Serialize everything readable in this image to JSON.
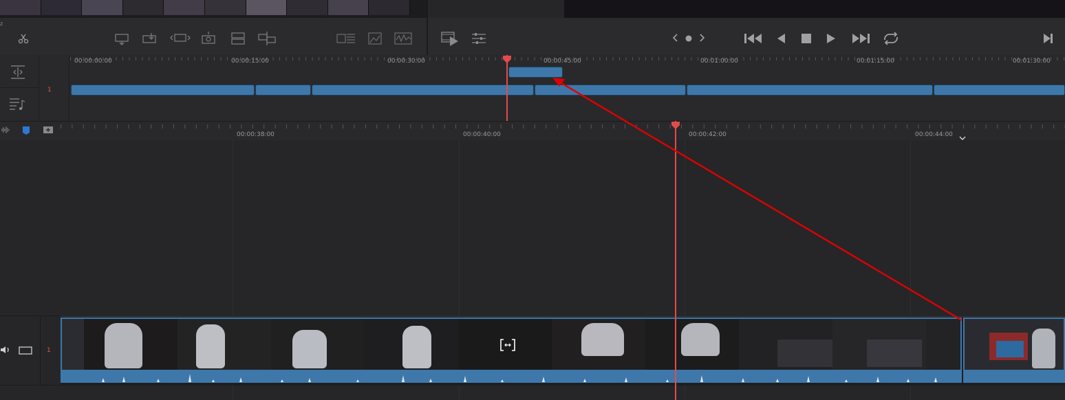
{
  "toolbar": {
    "left_icons": [
      "cut-icon",
      "insert-clip-icon",
      "overwrite-clip-icon",
      "replace-clip-icon",
      "place-on-top-icon",
      "append-icon",
      "ripple-overwrite-icon",
      "close-up-icon",
      "source-overwrite-icon",
      "audio-meter-icon"
    ],
    "right_icons": [
      "play-clip-icon",
      "settings-sliders-icon"
    ],
    "transport": [
      "prev-marker-icon",
      "marker-dot-icon",
      "next-marker-icon",
      "skip-start-icon",
      "play-reverse-icon",
      "stop-icon",
      "play-icon",
      "skip-end-icon",
      "loop-icon",
      "next-frame-icon"
    ]
  },
  "mini_timeline": {
    "track_number": "1",
    "ruler": [
      "00:00:00:00",
      "00:00:15:00",
      "00:00:30:00",
      "00:00:45:00",
      "00:01:00:00",
      "00:01:15:00",
      "00:01:30:00"
    ]
  },
  "main_timeline": {
    "ruler": [
      "00:00:38:00",
      "00:00:40:00",
      "00:00:42:00",
      "00:00:44:00"
    ],
    "video_track_number": "1",
    "colors": {
      "clip": "#3e78aa",
      "playhead": "#e24b4b",
      "arrow": "#e00000"
    }
  }
}
